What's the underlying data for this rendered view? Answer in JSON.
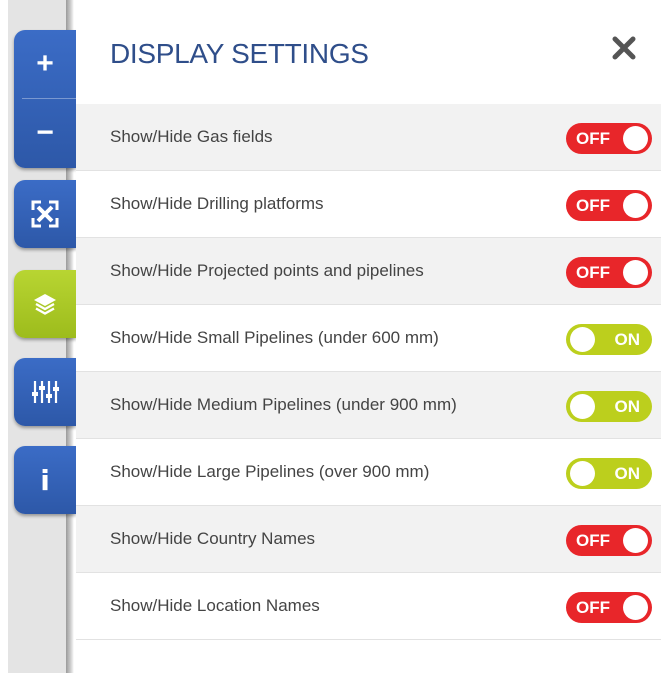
{
  "panel": {
    "title": "DISPLAY SETTINGS",
    "close_icon": "close-icon"
  },
  "side_controls": [
    {
      "name": "zoom-in",
      "icon": "plus-icon",
      "glyph": "+"
    },
    {
      "name": "zoom-out",
      "icon": "minus-icon",
      "glyph": "−"
    },
    {
      "name": "fullscreen",
      "icon": "fullscreen-icon"
    },
    {
      "name": "layers",
      "icon": "layers-icon"
    },
    {
      "name": "settings",
      "icon": "sliders-icon"
    },
    {
      "name": "info",
      "icon": "info-icon",
      "glyph": "i"
    }
  ],
  "settings": [
    {
      "label": "Show/Hide Gas fields",
      "state": "OFF"
    },
    {
      "label": "Show/Hide Drilling platforms",
      "state": "OFF"
    },
    {
      "label": "Show/Hide Projected points and pipelines",
      "state": "OFF"
    },
    {
      "label": "Show/Hide Small Pipelines (under 600 mm)",
      "state": "ON"
    },
    {
      "label": "Show/Hide Medium Pipelines (under 900 mm)",
      "state": "ON"
    },
    {
      "label": "Show/Hide Large Pipelines (over 900 mm)",
      "state": "ON"
    },
    {
      "label": "Show/Hide Country Names",
      "state": "OFF"
    },
    {
      "label": "Show/Hide Location Names",
      "state": "OFF"
    }
  ],
  "colors": {
    "off": "#e8262a",
    "on": "#bccf1d",
    "blue_control": "#3163b8",
    "green_control": "#a8c424",
    "title": "#2f4e8a"
  }
}
